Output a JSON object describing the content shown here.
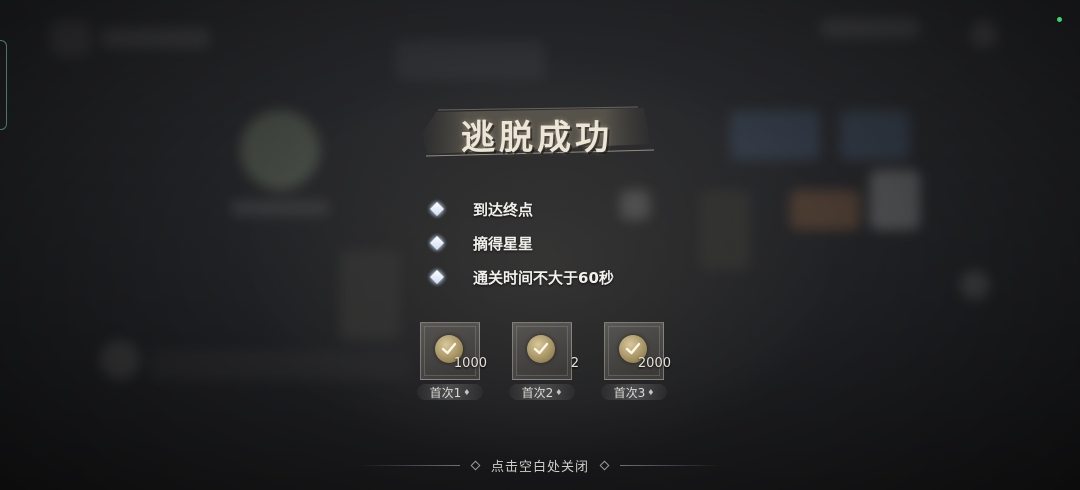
{
  "result": {
    "title": "逃脱成功"
  },
  "objectives": [
    {
      "label": "到达终点",
      "icon": "diamond-icon"
    },
    {
      "label": "摘得星星",
      "icon": "diamond-icon"
    },
    {
      "label": "通关时间不大于60秒",
      "icon": "diamond-icon"
    }
  ],
  "rewards": [
    {
      "count": "1000",
      "tag": "首次1",
      "icon": "check-badge-icon"
    },
    {
      "count": "2",
      "tag": "首次2",
      "icon": "check-badge-icon"
    },
    {
      "count": "2000",
      "tag": "首次3",
      "icon": "check-badge-icon"
    }
  ],
  "footer": {
    "close_hint": "点击空白处关闭"
  },
  "colors": {
    "status_dot": "#3bd66a",
    "badge_gold": "#d8c89a"
  }
}
